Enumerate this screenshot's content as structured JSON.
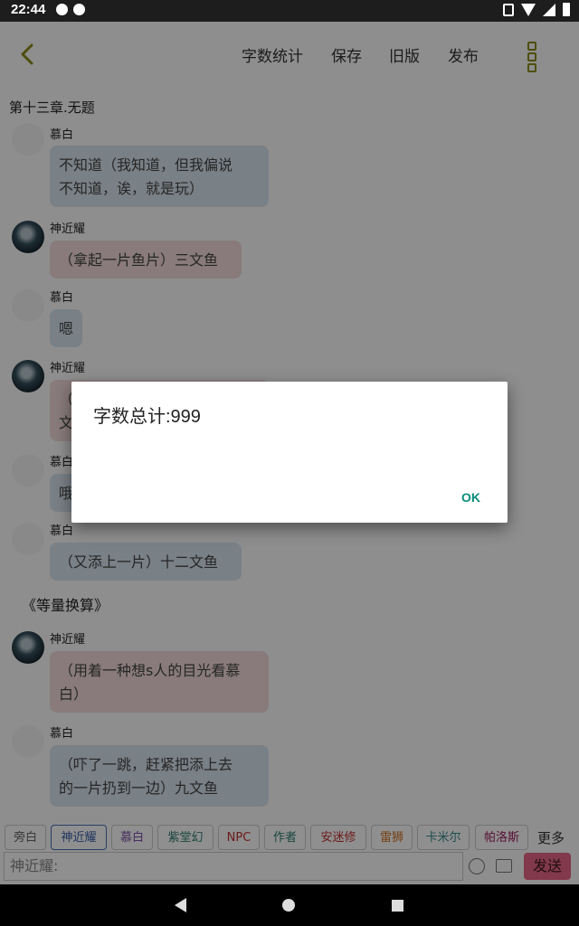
{
  "status_bar": {
    "time": "22:44"
  },
  "toolbar": {
    "word_count": "字数统计",
    "save": "保存",
    "old_version": "旧版",
    "publish": "发布"
  },
  "chapter_title": "第十三章.无题",
  "messages": [
    {
      "speaker": "慕白",
      "text": [
        "不知道（我知道，但我偏说",
        "不知道，诶，就是玩）"
      ]
    },
    {
      "speaker": "神近耀",
      "text": [
        "（拿起一片鱼片）三文鱼"
      ]
    },
    {
      "speaker": "慕白",
      "text": [
        "嗯"
      ]
    },
    {
      "speaker": "神近耀",
      "text": [
        "（",
        "文"
      ]
    },
    {
      "speaker": "慕白",
      "text": [
        "哦"
      ]
    },
    {
      "speaker": "慕白",
      "text": [
        "（又添上一片）十二文鱼"
      ]
    },
    {
      "speaker": "神近耀",
      "text": [
        "（用着一种想s人的目光看慕",
        "白）"
      ]
    },
    {
      "speaker": "慕白",
      "text": [
        "（吓了一跳，赶紧把添上去",
        "的一片扔到一边）九文鱼"
      ]
    }
  ],
  "aside_text": "《等量换算》",
  "characters": [
    "旁白",
    "神近耀",
    "慕白",
    "紫堂幻",
    "NPC",
    "作者",
    "安迷修",
    "雷狮",
    "卡米尔",
    "帕洛斯"
  ],
  "characters_more": "更多",
  "input": {
    "value": "神近耀:"
  },
  "send_label": "发送",
  "dialog": {
    "message": "字数总计:999",
    "ok_label": "OK"
  },
  "colors": {
    "accent": "#8b8b1a",
    "bubble_mubai": "#d8e4ef",
    "bubble_shenjinyao": "#f5dcdc",
    "send_button": "#e86787",
    "dialog_ok": "#088c7c"
  }
}
